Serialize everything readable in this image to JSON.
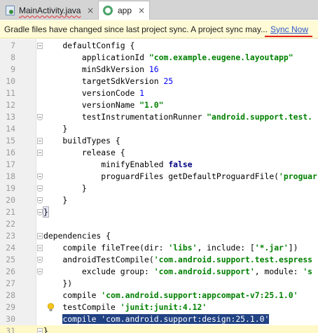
{
  "tabs": [
    {
      "label": "MainActivity.java",
      "close": "×"
    },
    {
      "label": "app",
      "close": "×"
    }
  ],
  "banner": {
    "message": "Gradle files have changed since last project sync. A project sync may...",
    "action": "Sync Now"
  },
  "colors": {
    "keyword": "#000080",
    "string": "#008000",
    "number": "#0000ff",
    "selection": "#214283",
    "banner_bg": "#fffbd6",
    "link": "#2d55c8"
  },
  "editor": {
    "lines": [
      {
        "n": "7",
        "text": "    defaultConfig {"
      },
      {
        "n": "8",
        "text": "        applicationId \"com.example.eugene.layoutapp\""
      },
      {
        "n": "9",
        "text": "        minSdkVersion 16"
      },
      {
        "n": "10",
        "text": "        targetSdkVersion 25"
      },
      {
        "n": "11",
        "text": "        versionCode 1"
      },
      {
        "n": "12",
        "text": "        versionName \"1.0\""
      },
      {
        "n": "13",
        "text": "        testInstrumentationRunner \"android.support.test."
      },
      {
        "n": "14",
        "text": "    }"
      },
      {
        "n": "15",
        "text": "    buildTypes {"
      },
      {
        "n": "16",
        "text": "        release {"
      },
      {
        "n": "17",
        "text": "            minifyEnabled false"
      },
      {
        "n": "18",
        "text": "            proguardFiles getDefaultProguardFile('proguar"
      },
      {
        "n": "19",
        "text": "        }"
      },
      {
        "n": "20",
        "text": "    }"
      },
      {
        "n": "21",
        "text": "}"
      },
      {
        "n": "22",
        "text": ""
      },
      {
        "n": "23",
        "text": "dependencies {"
      },
      {
        "n": "24",
        "text": "    compile fileTree(dir: 'libs', include: ['*.jar'])"
      },
      {
        "n": "25",
        "text": "    androidTestCompile('com.android.support.test.espress"
      },
      {
        "n": "26",
        "text": "        exclude group: 'com.android.support', module: 's"
      },
      {
        "n": "27",
        "text": "    })"
      },
      {
        "n": "28",
        "text": "    compile 'com.android.support:appcompat-v7:25.1.0'"
      },
      {
        "n": "29",
        "text": "    testCompile 'junit:junit:4.12'"
      },
      {
        "n": "30",
        "text": "    compile 'com.android.support:design:25.1.0'"
      },
      {
        "n": "31",
        "text": "}"
      }
    ]
  }
}
